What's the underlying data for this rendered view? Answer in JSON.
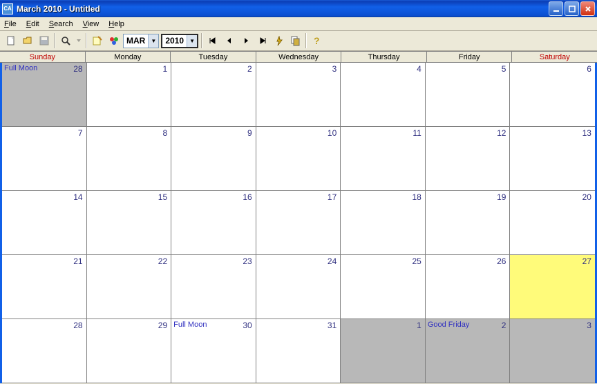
{
  "window": {
    "title": "March 2010 - Untitled",
    "appicon": "CA"
  },
  "menu": {
    "file": "File",
    "edit": "Edit",
    "search": "Search",
    "view": "View",
    "help": "Help"
  },
  "toolbar": {
    "month": "MAR",
    "year": "2010",
    "icons": {
      "new": "new-file-icon",
      "open": "open-folder-icon",
      "save": "save-icon",
      "find": "find-icon",
      "drop": "dropdown-icon",
      "edit": "edit-note-icon",
      "cat": "categories-icon",
      "first": "first-icon",
      "prev": "prev-icon",
      "next": "next-icon",
      "last": "last-icon",
      "flash": "flash-icon",
      "copy": "copy-icon",
      "help": "help-icon"
    }
  },
  "headers": [
    "Sunday",
    "Monday",
    "Tuesday",
    "Wednesday",
    "Thursday",
    "Friday",
    "Saturday"
  ],
  "cells": [
    {
      "n": "28",
      "evt": "Full Moon",
      "out": true
    },
    {
      "n": "1"
    },
    {
      "n": "2"
    },
    {
      "n": "3"
    },
    {
      "n": "4"
    },
    {
      "n": "5"
    },
    {
      "n": "6"
    },
    {
      "n": "7"
    },
    {
      "n": "8"
    },
    {
      "n": "9"
    },
    {
      "n": "10"
    },
    {
      "n": "11"
    },
    {
      "n": "12"
    },
    {
      "n": "13"
    },
    {
      "n": "14"
    },
    {
      "n": "15"
    },
    {
      "n": "16"
    },
    {
      "n": "17"
    },
    {
      "n": "18"
    },
    {
      "n": "19"
    },
    {
      "n": "20"
    },
    {
      "n": "21"
    },
    {
      "n": "22"
    },
    {
      "n": "23"
    },
    {
      "n": "24"
    },
    {
      "n": "25"
    },
    {
      "n": "26"
    },
    {
      "n": "27",
      "hl": true
    },
    {
      "n": "28"
    },
    {
      "n": "29"
    },
    {
      "n": "30",
      "evt": "Full Moon"
    },
    {
      "n": "31"
    },
    {
      "n": "1",
      "out": true
    },
    {
      "n": "2",
      "evt": "Good Friday",
      "out": true
    },
    {
      "n": "3",
      "out": true
    }
  ]
}
